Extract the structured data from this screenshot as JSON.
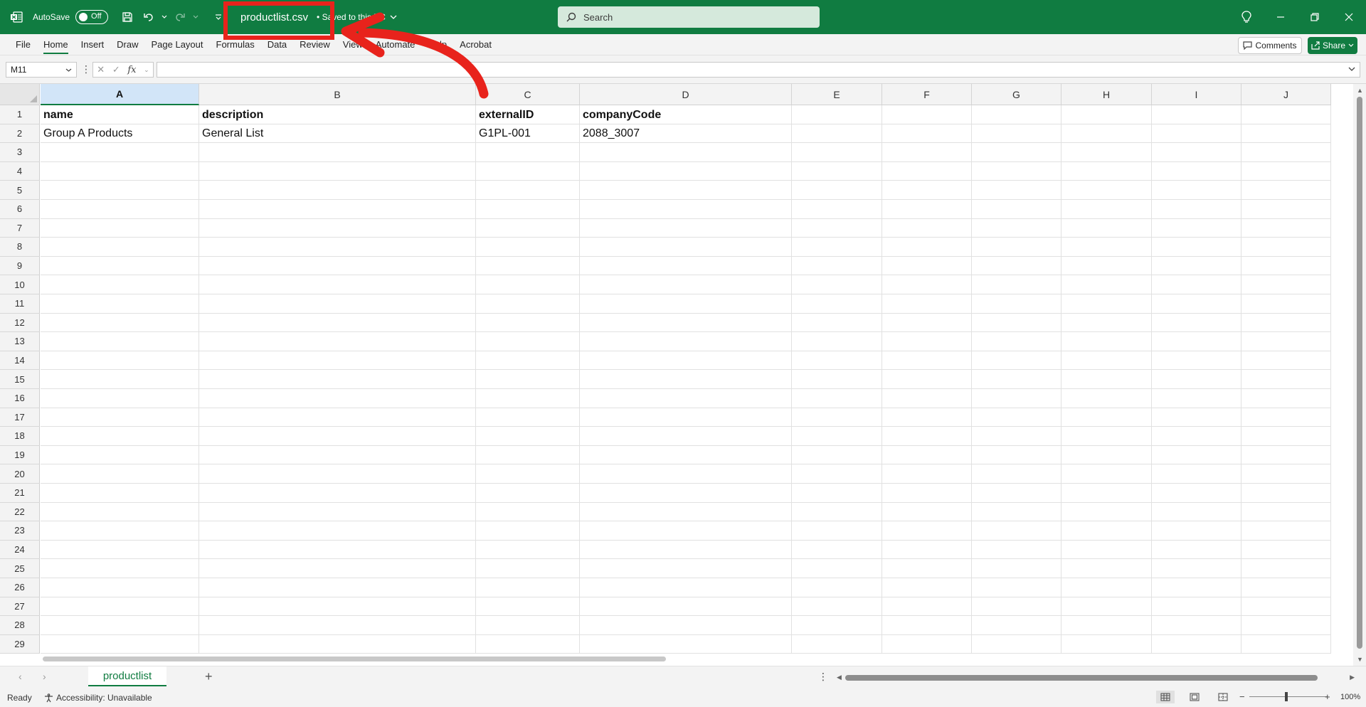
{
  "titlebar": {
    "autosave_label": "AutoSave",
    "autosave_state": "Off",
    "filename": "productlist.csv",
    "saved_status": "• Saved to this PC",
    "search_placeholder": "Search"
  },
  "ribbon": {
    "tabs": [
      "File",
      "Home",
      "Insert",
      "Draw",
      "Page Layout",
      "Formulas",
      "Data",
      "Review",
      "View",
      "Automate",
      "Help",
      "Acrobat"
    ],
    "active_tab": "Home",
    "comments_label": "Comments",
    "share_label": "Share"
  },
  "formula_bar": {
    "name_box": "M11",
    "fx_label": "fx",
    "formula_value": ""
  },
  "grid": {
    "columns": [
      "A",
      "B",
      "C",
      "D",
      "E",
      "F",
      "G",
      "H",
      "I",
      "J"
    ],
    "selected_column": "A",
    "row_numbers": [
      "1",
      "2",
      "3",
      "4",
      "5",
      "6",
      "7",
      "8",
      "9",
      "10",
      "11",
      "12",
      "13",
      "14",
      "15",
      "16",
      "17",
      "18",
      "19",
      "20",
      "21",
      "22",
      "23",
      "24",
      "25",
      "26",
      "27",
      "28",
      "29"
    ],
    "rows": [
      [
        "name",
        "description",
        "externalID",
        "companyCode"
      ],
      [
        "Group A Products",
        "General List",
        "G1PL-001",
        "2088_3007"
      ]
    ]
  },
  "sheets": {
    "tabs": [
      "productlist"
    ],
    "active": "productlist"
  },
  "status": {
    "ready": "Ready",
    "accessibility": "Accessibility: Unavailable",
    "zoom": "100%"
  },
  "colors": {
    "excel_green": "#107c41",
    "annotation_red": "#e8231c"
  }
}
